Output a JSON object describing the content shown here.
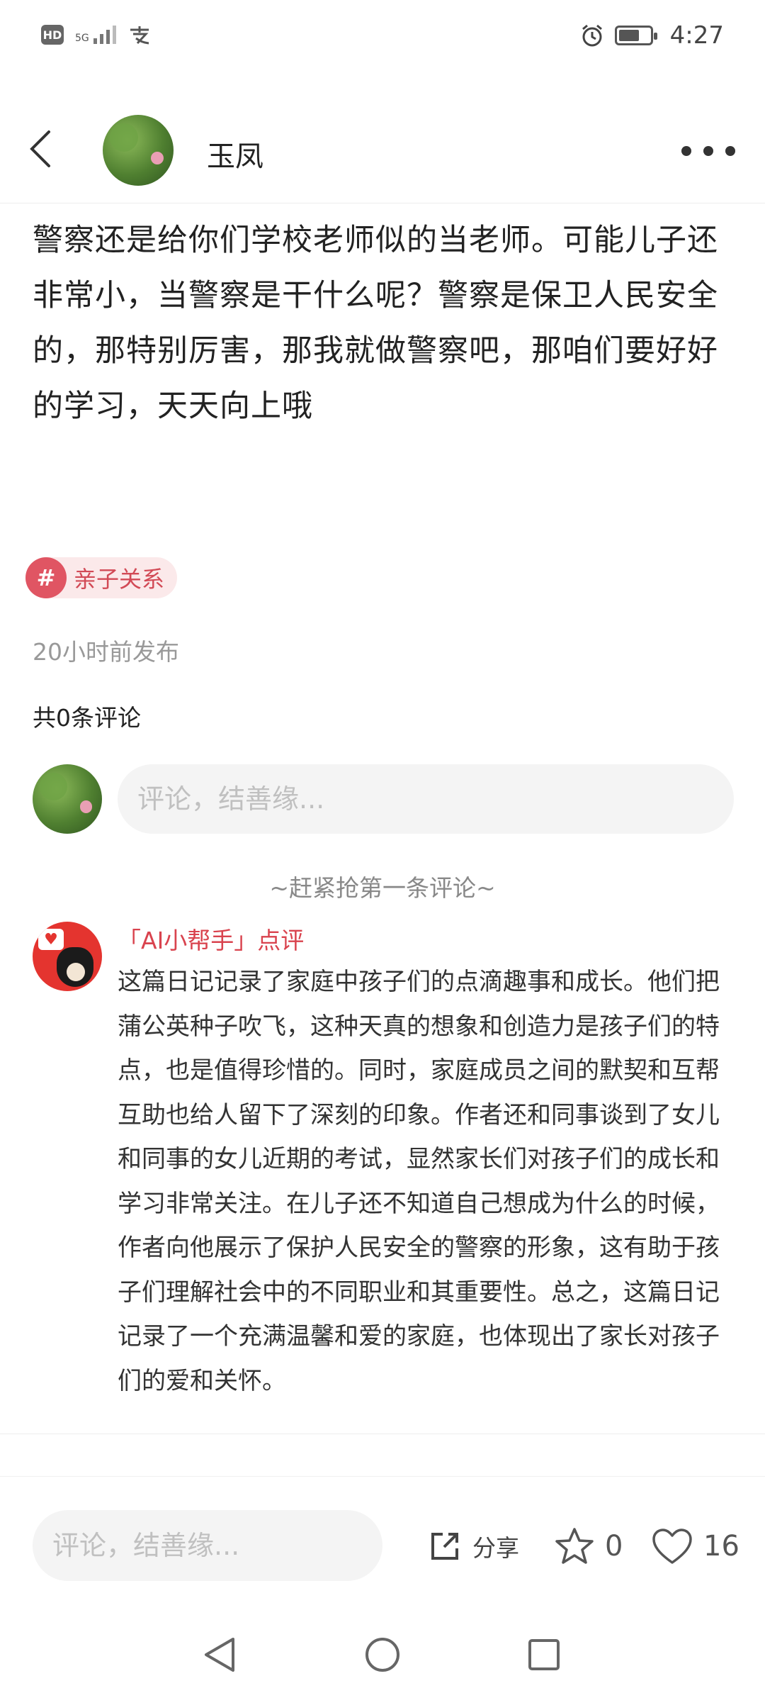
{
  "status_bar": {
    "network": "5G",
    "time": "4:27"
  },
  "header": {
    "username": "玉凤"
  },
  "article": {
    "text": "警察还是给你们学校老师似的当老师。可能儿子还非常小，当警察是干什么呢？警察是保卫人民安全的，那特别厉害，那我就做警察吧，那咱们要好好的学习，天天向上哦",
    "tag_hash": "#",
    "tag": "亲子关系",
    "post_time": "20小时前发布",
    "comment_count": "共0条评论"
  },
  "comment_box": {
    "placeholder": "评论，结善缘..."
  },
  "first_comment_hint": "~赶紧抢第一条评论~",
  "ai_comment": {
    "title": "「AI小帮手」点评",
    "body": "这篇日记记录了家庭中孩子们的点滴趣事和成长。他们把蒲公英种子吹飞，这种天真的想象和创造力是孩子们的特点，也是值得珍惜的。同时，家庭成员之间的默契和互帮互助也给人留下了深刻的印象。作者还和同事谈到了女儿和同事的女儿近期的考试，显然家长们对孩子们的成长和学习非常关注。在儿子还不知道自己想成为什么的时候，作者向他展示了保护人民安全的警察的形象，这有助于孩子们理解社会中的不同职业和其重要性。总之，这篇日记记录了一个充满温馨和爱的家庭，也体现出了家长对孩子们的爱和关怀。"
  },
  "bottom_bar": {
    "placeholder": "评论，结善缘...",
    "share_label": "分享",
    "favorite_count": "0",
    "like_count": "16"
  },
  "icons": {
    "back": "chevron-left-icon",
    "more": "more-dots-icon",
    "share": "share-icon",
    "favorite": "star-icon",
    "like": "heart-icon"
  },
  "colors": {
    "accent": "#e05563",
    "tag_bg": "#fbe9ea",
    "ai_title": "#d9434e"
  }
}
